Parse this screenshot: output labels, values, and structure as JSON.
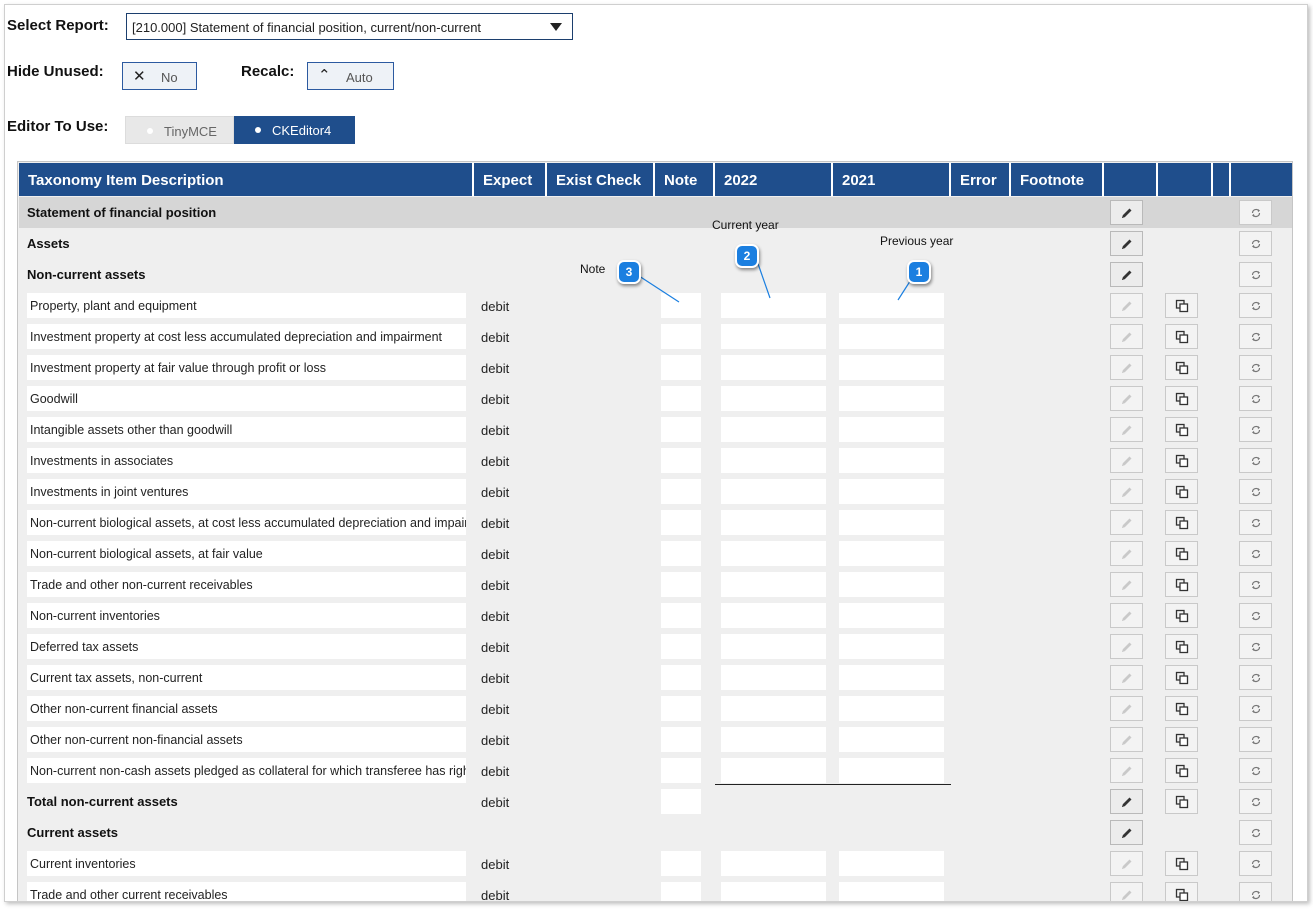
{
  "controls": {
    "select_report_label": "Select Report:",
    "select_report_value": "[210.000] Statement of financial position, current/non-current",
    "hide_unused_label": "Hide Unused:",
    "hide_unused_value": "No",
    "recalc_label": "Recalc:",
    "recalc_value": "Auto",
    "editor_label": "Editor To Use:",
    "editor_options": [
      "TinyMCE",
      "CKEditor4"
    ],
    "editor_selected": "CKEditor4"
  },
  "columns": [
    "Taxonomy Item Description",
    "Expect",
    "Exist Check",
    "Note",
    "2022",
    "2021",
    "Error",
    "Footnote",
    "",
    "",
    "",
    ""
  ],
  "callouts": [
    {
      "number": "1",
      "text": "Previous year"
    },
    {
      "number": "2",
      "text": "Current year"
    },
    {
      "number": "3",
      "text": "Note"
    }
  ],
  "sections": [
    {
      "label": "Statement of financial position"
    },
    {
      "label": "Assets"
    },
    {
      "label": "Non-current assets"
    },
    {
      "label": "Total non-current assets",
      "expect": "debit"
    },
    {
      "label": "Current assets"
    }
  ],
  "rows": [
    {
      "label": "Property, plant and equipment",
      "expect": "debit"
    },
    {
      "label": "Investment property at cost less accumulated depreciation and impairment",
      "expect": "debit"
    },
    {
      "label": "Investment property at fair value through profit or loss",
      "expect": "debit"
    },
    {
      "label": "Goodwill",
      "expect": "debit"
    },
    {
      "label": "Intangible assets other than goodwill",
      "expect": "debit"
    },
    {
      "label": "Investments in associates",
      "expect": "debit"
    },
    {
      "label": "Investments in joint ventures",
      "expect": "debit"
    },
    {
      "label": "Non-current biological assets, at cost less accumulated depreciation and impairment",
      "expect": "debit"
    },
    {
      "label": "Non-current biological assets, at fair value",
      "expect": "debit"
    },
    {
      "label": "Trade and other non-current receivables",
      "expect": "debit"
    },
    {
      "label": "Non-current inventories",
      "expect": "debit"
    },
    {
      "label": "Deferred tax assets",
      "expect": "debit"
    },
    {
      "label": "Current tax assets, non-current",
      "expect": "debit"
    },
    {
      "label": "Other non-current financial assets",
      "expect": "debit"
    },
    {
      "label": "Other non-current non-financial assets",
      "expect": "debit"
    },
    {
      "label": "Non-current non-cash assets pledged as collateral for which transferee has right to sell or repledge collateral",
      "expect": "debit"
    }
  ],
  "current_rows": [
    {
      "label": "Current inventories",
      "expect": "debit"
    },
    {
      "label": "Trade and other current receivables",
      "expect": "debit"
    }
  ],
  "icons": {
    "edit": "pencil-icon",
    "copy": "copy-icon",
    "refresh": "refresh-icon"
  },
  "colors": {
    "header": "#1f4e8c",
    "callout": "#1b7fe0"
  }
}
